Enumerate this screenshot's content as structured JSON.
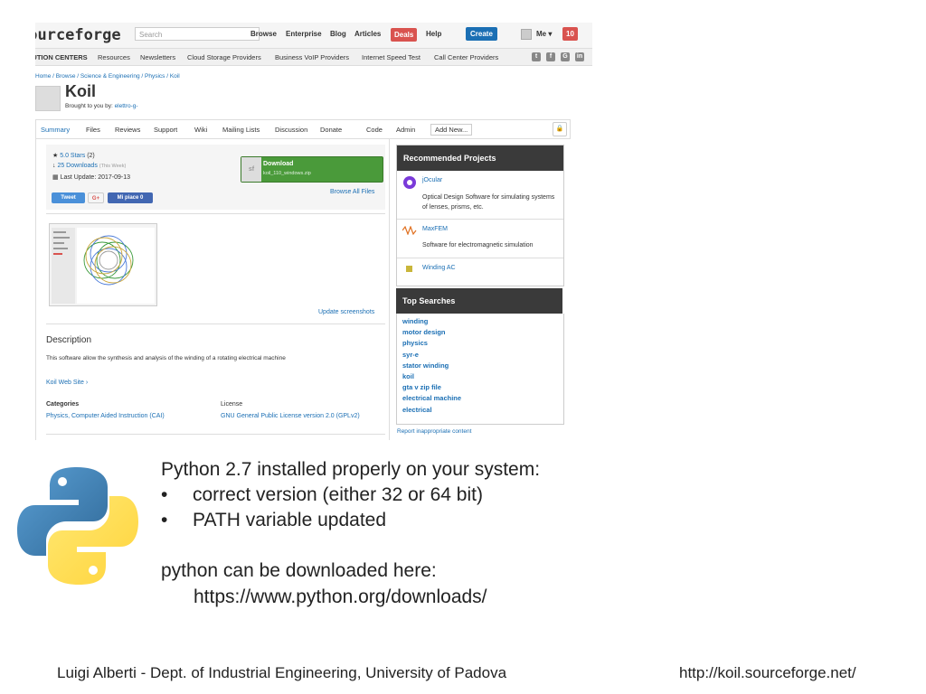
{
  "topbar": {
    "logo": "sourceforge",
    "search_placeholder": "Search",
    "nav": [
      "Browse",
      "Enterprise",
      "Blog",
      "Articles"
    ],
    "deals": "Deals",
    "help": "Help",
    "create": "Create",
    "me": "Me ▾",
    "notifications": "10"
  },
  "subbar": {
    "items": [
      "SOLUTION CENTERS",
      "Resources",
      "Newsletters",
      "Cloud Storage Providers",
      "Business VoIP Providers",
      "Internet Speed Test",
      "Call Center Providers"
    ],
    "social": [
      "twitter-icon",
      "facebook-icon",
      "google-icon",
      "linkedin-icon"
    ]
  },
  "breadcrumb": "Home / Browse / Science & Engineering / Physics / Koil",
  "project": {
    "title": "Koil",
    "brought_by": "Brought to you by: ",
    "author": "elettro-g-"
  },
  "tabs": [
    "Summary",
    "Files",
    "Reviews",
    "Support",
    "Wiki",
    "Mailing Lists",
    "Discussion",
    "Donate",
    "Code",
    "Admin",
    "Add New..."
  ],
  "stats": {
    "stars": "5.0 Stars",
    "stars_count": "(2)",
    "downloads": "25 Downloads",
    "downloads_period": "(This Week)",
    "last_update": "Last Update: 2017-09-13"
  },
  "download": {
    "label": "Download",
    "file": "koil_110_windows.zip",
    "browse_all": "Browse All Files"
  },
  "share": {
    "tweet": "Tweet",
    "gplus": "G+",
    "like": "Mi piace 0"
  },
  "screenshots": {
    "update": "Update screenshots"
  },
  "description": {
    "heading": "Description",
    "text": "This software allow the synthesis and analysis of the winding of a rotating electrical machine",
    "website": "Koil Web Site ›"
  },
  "categories": {
    "heading": "Categories",
    "value": "Physics, Computer Aided Instruction (CAI)"
  },
  "license": {
    "heading": "License",
    "value": "GNU General Public License version 2.0 (GPLv2)"
  },
  "recommended": {
    "heading": "Recommended Projects",
    "items": [
      {
        "name": "jOcular",
        "desc": "Optical Design Software for simulating systems of lenses, prisms, etc."
      },
      {
        "name": "MaxFEM",
        "desc": "Software for electromagnetic simulation"
      },
      {
        "name": "Winding AC",
        "desc": ""
      }
    ]
  },
  "top_searches": {
    "heading": "Top Searches",
    "items": [
      "winding",
      "motor design",
      "physics",
      "syr-e",
      "stator winding",
      "koil",
      "gta v zip file",
      "electrical machine",
      "electrical"
    ]
  },
  "report": "Report inappropriate content",
  "slide": {
    "line1": "Python 2.7 installed properly on your system:",
    "bullet1": "correct version (either 32 or 64 bit)",
    "bullet2": "PATH variable updated",
    "line2": "python can be downloaded here:",
    "url": "https://www.python.org/downloads/"
  },
  "footer": {
    "left": "Luigi Alberti - Dept. of Industrial Engineering, University of Padova",
    "right": "http://koil.sourceforge.net/"
  },
  "colors": {
    "accent": "#1b6fb4",
    "download_green": "#4a9a3a",
    "deals_red": "#d9534f",
    "panel_header": "#3a3a3a"
  }
}
